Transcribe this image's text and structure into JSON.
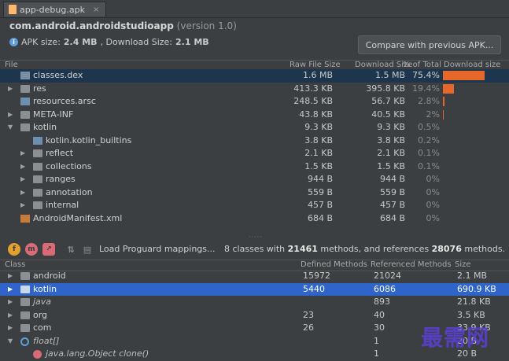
{
  "tab": {
    "label": "app-debug.apk",
    "close": "×"
  },
  "package": {
    "name": "com.android.androidstudioapp",
    "version": "(version 1.0)"
  },
  "size_info": {
    "label_apk": "APK size: ",
    "apk_size": "2.4 MB",
    "label_dl": ", Download Size: ",
    "download_size": "2.1 MB"
  },
  "compare_button": "Compare with previous APK...",
  "file_table": {
    "headers": [
      "File",
      "Raw File Size",
      "Download Size",
      "% of Total",
      "Download size"
    ],
    "rows": [
      {
        "name": "classes.dex",
        "raw": "1.6 MB",
        "dl": "1.5 MB",
        "pct": "75.4%",
        "share": 0.754,
        "selected": true
      },
      {
        "name": "res",
        "raw": "413.3 KB",
        "dl": "395.8 KB",
        "pct": "19.4%",
        "share": 0.194
      },
      {
        "name": "resources.arsc",
        "raw": "248.5 KB",
        "dl": "56.7 KB",
        "pct": "2.8%",
        "share": 0.028
      },
      {
        "name": "META-INF",
        "raw": "43.8 KB",
        "dl": "40.5 KB",
        "pct": "2%",
        "share": 0.02
      },
      {
        "name": "kotlin",
        "raw": "9.3 KB",
        "dl": "9.3 KB",
        "pct": "0.5%",
        "share": 0.005
      },
      {
        "name": "kotlin.kotlin_builtins",
        "raw": "3.8 KB",
        "dl": "3.8 KB",
        "pct": "0.2%",
        "share": 0.002
      },
      {
        "name": "reflect",
        "raw": "2.1 KB",
        "dl": "2.1 KB",
        "pct": "0.1%",
        "share": 0.001
      },
      {
        "name": "collections",
        "raw": "1.5 KB",
        "dl": "1.5 KB",
        "pct": "0.1%",
        "share": 0.001
      },
      {
        "name": "ranges",
        "raw": "944 B",
        "dl": "944 B",
        "pct": "0%",
        "share": 0
      },
      {
        "name": "annotation",
        "raw": "559 B",
        "dl": "559 B",
        "pct": "0%",
        "share": 0
      },
      {
        "name": "internal",
        "raw": "457 B",
        "dl": "457 B",
        "pct": "0%",
        "share": 0
      },
      {
        "name": "AndroidManifest.xml",
        "raw": "684 B",
        "dl": "684 B",
        "pct": "0%",
        "share": 0
      }
    ]
  },
  "dex_toolbar": {
    "load_proguard": "Load Proguard mappings...",
    "summary_pre": "8 classes with ",
    "methods": "21461",
    "summary_mid": " methods, and references ",
    "references": "28076",
    "summary_post": " methods."
  },
  "class_table": {
    "headers": [
      "Class",
      "Defined Methods",
      "Referenced Methods",
      "Size"
    ],
    "rows": [
      {
        "name": "android",
        "defined": "15972",
        "referenced": "21024",
        "size": "2.1 MB"
      },
      {
        "name": "kotlin",
        "defined": "5440",
        "referenced": "6086",
        "size": "690.9 KB",
        "selected": true
      },
      {
        "name": "java",
        "defined": "",
        "referenced": "893",
        "size": "21.8 KB"
      },
      {
        "name": "org",
        "defined": "23",
        "referenced": "40",
        "size": "3.5 KB"
      },
      {
        "name": "com",
        "defined": "26",
        "referenced": "30",
        "size": "33.9 KB"
      },
      {
        "name": "float[]",
        "defined": "",
        "referenced": "1",
        "size": "20 B"
      },
      {
        "name": "java.lang.Object clone()",
        "defined": "",
        "referenced": "1",
        "size": "20 B"
      }
    ]
  },
  "watermark": "最需网",
  "colors": {
    "accent_bar": "#e5672a",
    "selection": "#2f65ca",
    "background": "#3c3f41"
  }
}
